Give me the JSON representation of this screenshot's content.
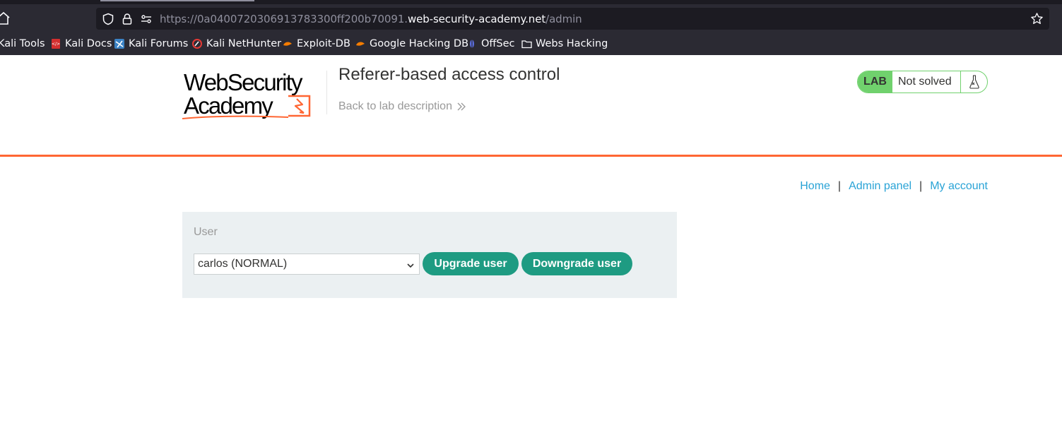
{
  "browser": {
    "url_prefix": "https://0a0400720306913783300ff200b70091.",
    "url_host": "web-security-academy.net",
    "url_path": "/admin",
    "bookmarks": [
      {
        "label": "Kali Tools",
        "icon": "kali-tools-icon"
      },
      {
        "label": "Kali Docs",
        "icon": "kali-docs-icon"
      },
      {
        "label": "Kali Forums",
        "icon": "kali-forums-icon"
      },
      {
        "label": "Kali NetHunter",
        "icon": "kali-nethunter-icon"
      },
      {
        "label": "Exploit-DB",
        "icon": "exploit-db-icon"
      },
      {
        "label": "Google Hacking DB",
        "icon": "ghdb-icon"
      },
      {
        "label": "OffSec",
        "icon": "offsec-icon"
      },
      {
        "label": "Webs Hacking",
        "icon": "folder-icon"
      }
    ]
  },
  "header": {
    "logo_line1": "WebSecurity",
    "logo_line2": "Academy",
    "lab_title": "Referer-based access control",
    "back_link": "Back to lab description",
    "lab_badge": "LAB",
    "lab_status": "Not solved"
  },
  "nav": {
    "home": "Home",
    "sep1": "|",
    "admin_panel": "Admin panel",
    "sep2": "|",
    "my_account": "My account"
  },
  "admin": {
    "user_label": "User",
    "selected_user": "carlos (NORMAL)",
    "upgrade_button": "Upgrade user",
    "downgrade_button": "Downgrade user"
  },
  "colors": {
    "accent_orange": "#ff6633",
    "button_green": "#1e9b82",
    "lab_green": "#70d16d",
    "link_blue": "#29a3d6"
  }
}
